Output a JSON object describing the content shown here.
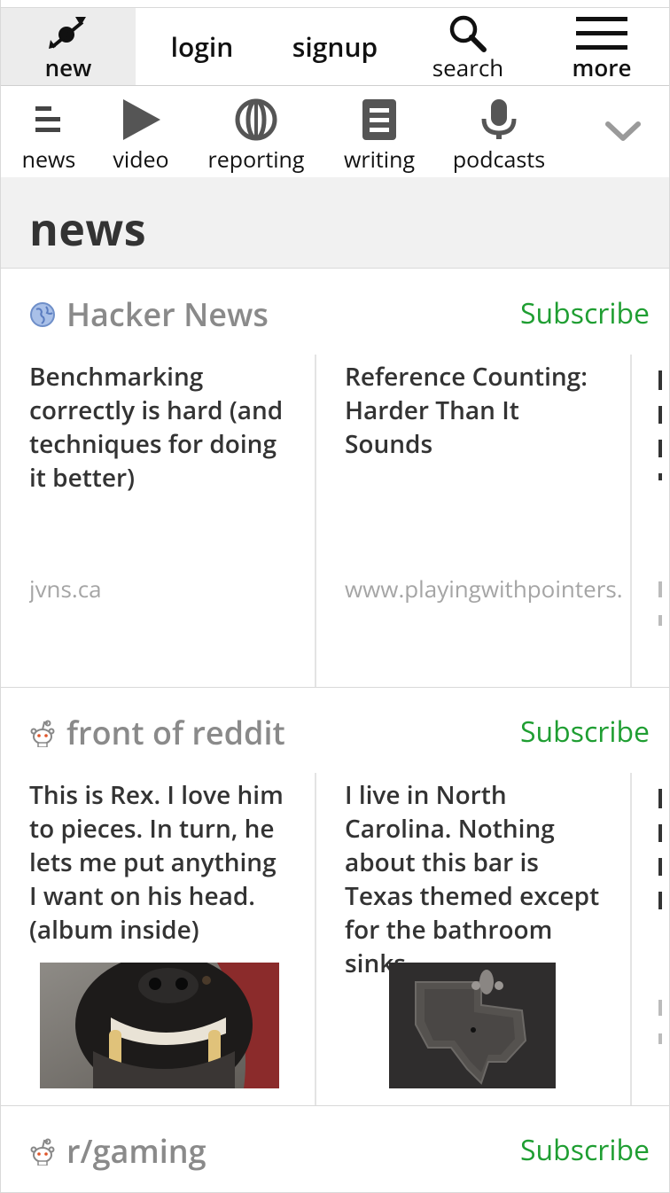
{
  "topnav": {
    "new_label": "new",
    "login_label": "login",
    "signup_label": "signup",
    "search_label": "search",
    "more_label": "more"
  },
  "categories": [
    {
      "label": "news",
      "icon": "list-icon"
    },
    {
      "label": "video",
      "icon": "play-icon"
    },
    {
      "label": "reporting",
      "icon": "globe-icon"
    },
    {
      "label": "writing",
      "icon": "document-icon"
    },
    {
      "label": "podcasts",
      "icon": "microphone-icon"
    }
  ],
  "section": {
    "title": "news"
  },
  "feeds": [
    {
      "name": "Hacker News",
      "subscribe": "Subscribe",
      "icon": "globe-icon",
      "cards": [
        {
          "title": "Benchmarking correctly is hard (and techniques for doing it better)",
          "domain": "jvns.ca"
        },
        {
          "title": "Reference Counting: Harder Than It Sounds",
          "domain": "www.playingwithpointers.com"
        }
      ]
    },
    {
      "name": "front of reddit",
      "subscribe": "Subscribe",
      "icon": "reddit-alien-icon",
      "cards": [
        {
          "title": "This is Rex. I love him to pieces. In turn, he lets me put anything I want on his head. (album inside)",
          "image": "dog-photo"
        },
        {
          "title": "I live in North Carolina. Nothing about this bar is Texas themed except for the bathroom sinks.",
          "image": "texas-sink-photo"
        }
      ]
    },
    {
      "name": "r/gaming",
      "subscribe": "Subscribe",
      "icon": "reddit-alien-icon"
    }
  ],
  "colors": {
    "subscribe": "#1f9e32",
    "header_bg": "#f1f1f1",
    "feed_name": "#8a8a8a"
  }
}
